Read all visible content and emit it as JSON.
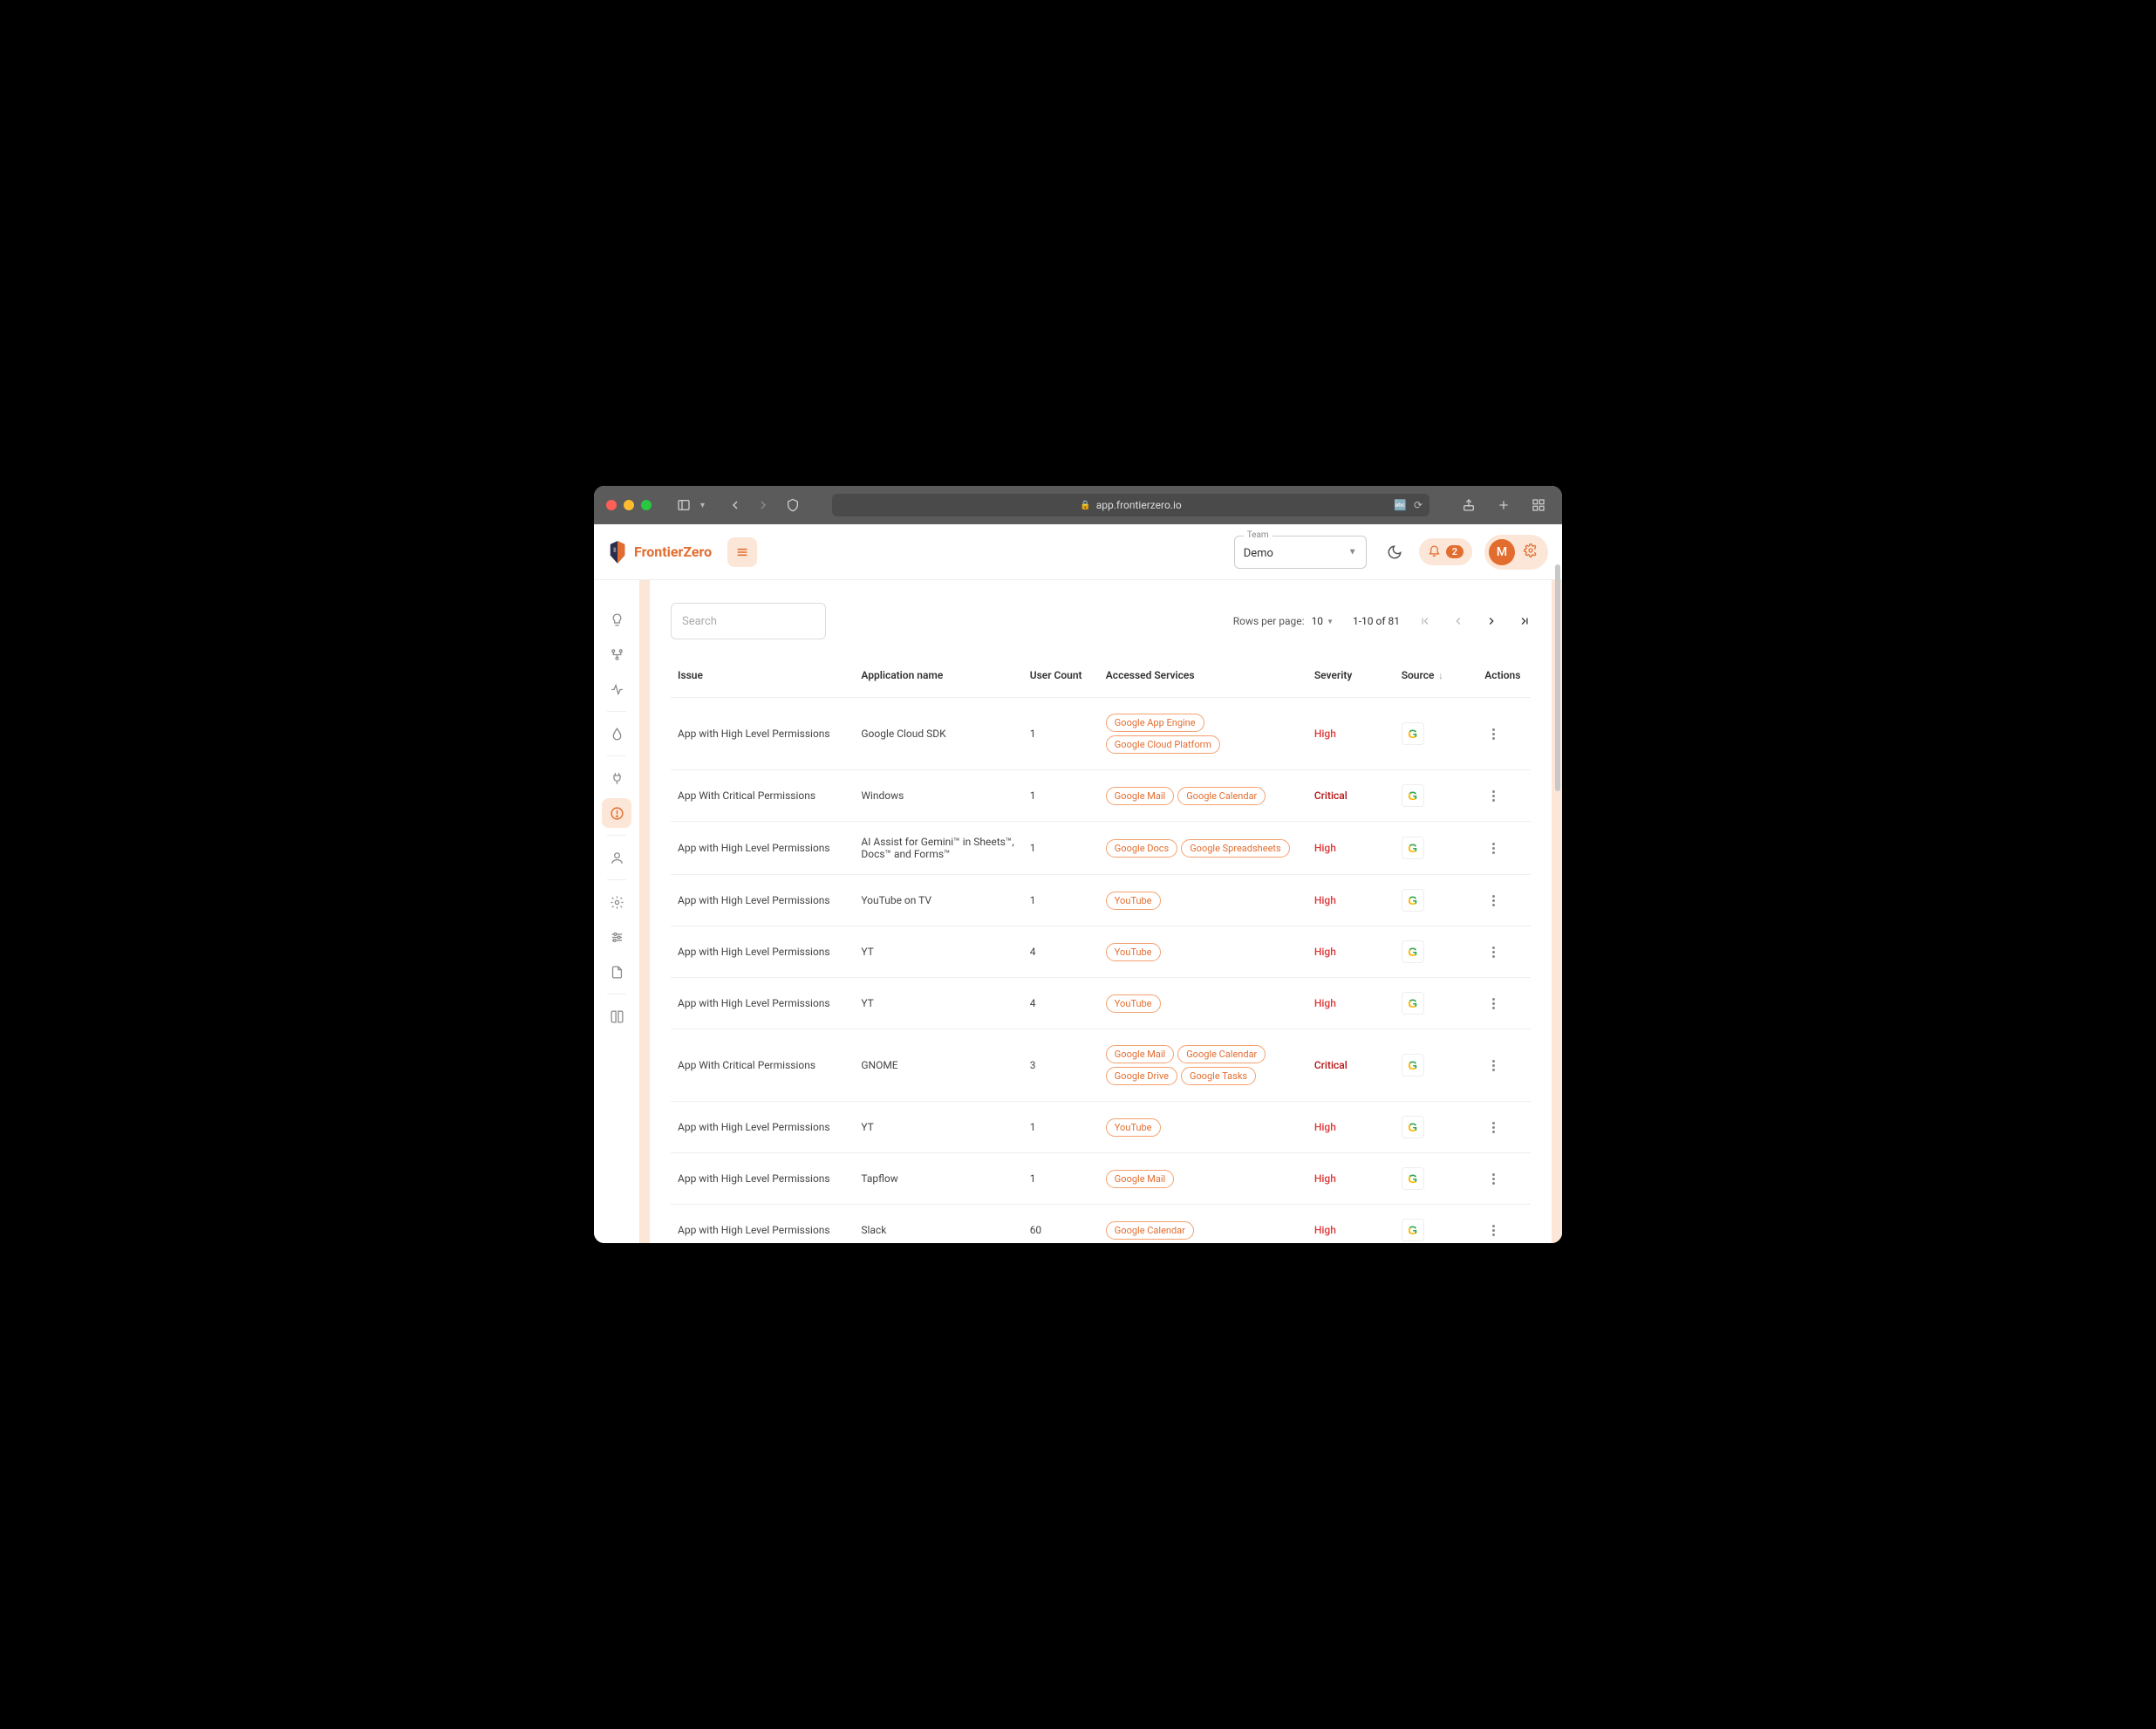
{
  "browser": {
    "url_display": "app.frontierzero.io"
  },
  "header": {
    "brand": "FrontierZero",
    "team_label": "Team",
    "team_value": "Demo",
    "notification_count": "2",
    "avatar_initial": "M"
  },
  "search": {
    "placeholder": "Search"
  },
  "pagination": {
    "rpp_label": "Rows per page:",
    "rpp_value": "10",
    "range_text": "1-10 of 81"
  },
  "columns": {
    "issue": "Issue",
    "app": "Application name",
    "user_count": "User Count",
    "services": "Accessed Services",
    "severity": "Severity",
    "source": "Source",
    "actions": "Actions"
  },
  "rows": [
    {
      "issue": "App with High Level Permissions",
      "app": "Google Cloud SDK",
      "user_count": "1",
      "services": [
        "Google App Engine",
        "Google Cloud Platform"
      ],
      "severity": "High",
      "source": "google"
    },
    {
      "issue": "App With Critical Permissions",
      "app": "Windows",
      "user_count": "1",
      "services": [
        "Google Mail",
        "Google Calendar"
      ],
      "severity": "Critical",
      "source": "google"
    },
    {
      "issue": "App with High Level Permissions",
      "app": "AI Assist for Gemini™ in Sheets™, Docs™ and Forms™",
      "user_count": "1",
      "services": [
        "Google Docs",
        "Google Spreadsheets"
      ],
      "severity": "High",
      "source": "google"
    },
    {
      "issue": "App with High Level Permissions",
      "app": "YouTube on TV",
      "user_count": "1",
      "services": [
        "YouTube"
      ],
      "severity": "High",
      "source": "google"
    },
    {
      "issue": "App with High Level Permissions",
      "app": "YT",
      "user_count": "4",
      "services": [
        "YouTube"
      ],
      "severity": "High",
      "source": "google"
    },
    {
      "issue": "App with High Level Permissions",
      "app": "YT",
      "user_count": "4",
      "services": [
        "YouTube"
      ],
      "severity": "High",
      "source": "google"
    },
    {
      "issue": "App With Critical Permissions",
      "app": "GNOME",
      "user_count": "3",
      "services": [
        "Google Mail",
        "Google Calendar",
        "Google Drive",
        "Google Tasks"
      ],
      "severity": "Critical",
      "source": "google"
    },
    {
      "issue": "App with High Level Permissions",
      "app": "YT",
      "user_count": "1",
      "services": [
        "YouTube"
      ],
      "severity": "High",
      "source": "google"
    },
    {
      "issue": "App with High Level Permissions",
      "app": "Tapflow",
      "user_count": "1",
      "services": [
        "Google Mail"
      ],
      "severity": "High",
      "source": "google"
    },
    {
      "issue": "App with High Level Permissions",
      "app": "Slack",
      "user_count": "60",
      "services": [
        "Google Calendar"
      ],
      "severity": "High",
      "source": "google"
    }
  ]
}
